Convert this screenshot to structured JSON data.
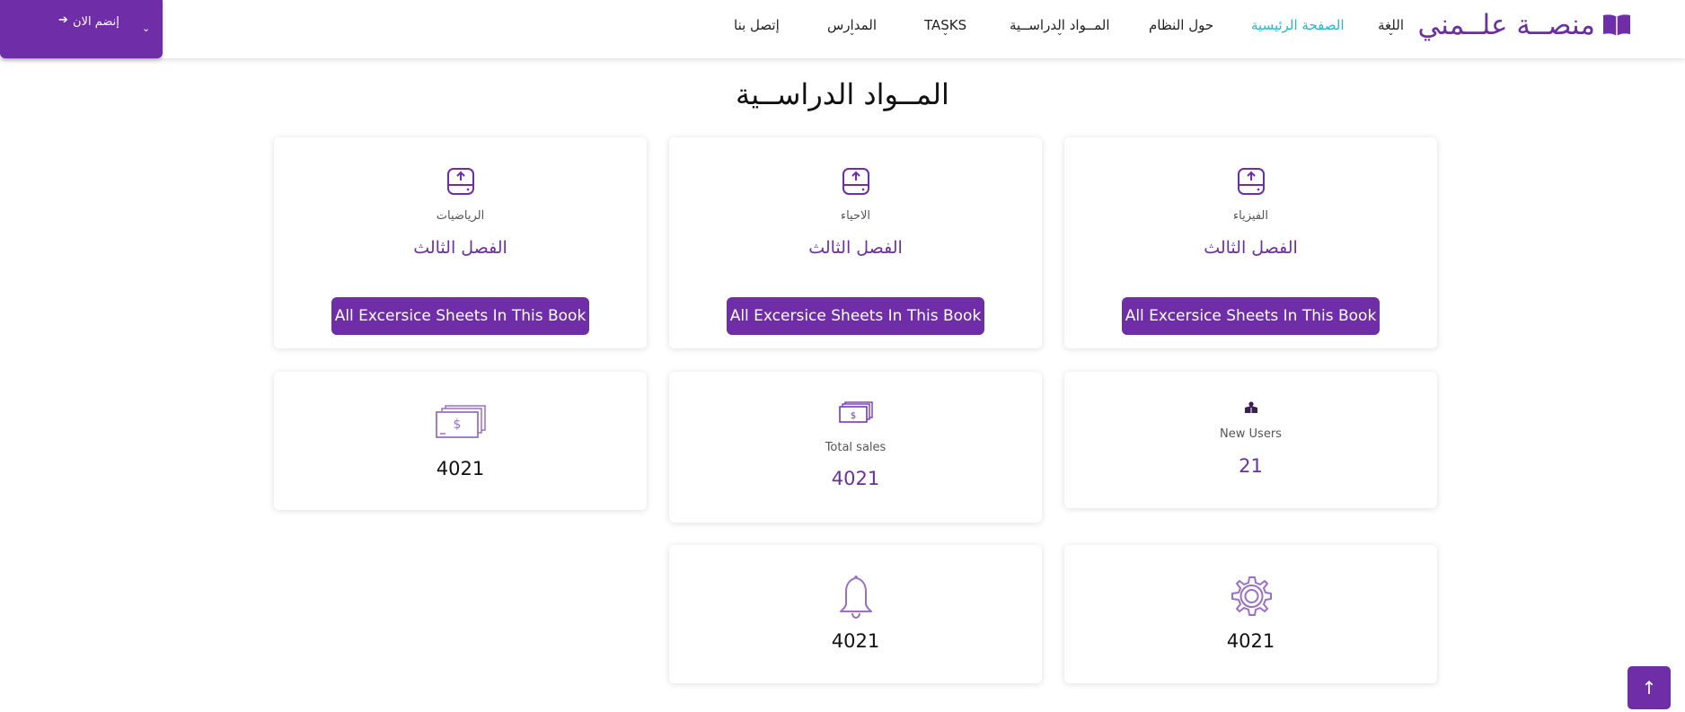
{
  "navbar": {
    "brand": "منصــة علــمني",
    "items": [
      {
        "label": "اللغة",
        "has_caret": true
      },
      {
        "label": "الصفحة الرئيسية",
        "active": true
      },
      {
        "label": "حول النظام"
      },
      {
        "label": "المــواد الدراســية",
        "has_caret": true
      },
      {
        "label": "TASKS",
        "has_caret": true
      },
      {
        "label": "المدارس",
        "has_caret": true
      },
      {
        "label": "إتصل بنا"
      }
    ],
    "join_label": "إنضم الان",
    "join_arrow": "➔",
    "caret": "⌄"
  },
  "section_title": "المــواد الدراســية",
  "subjects": [
    {
      "name": "الفيزياء",
      "term": "الفصل الثالث",
      "button": "All Excersice Sheets In This Book"
    },
    {
      "name": "الاحياء",
      "term": "الفصل الثالث",
      "button": "All Excersice Sheets In This Book"
    },
    {
      "name": "الرياضيات",
      "term": "الفصل الثالث",
      "button": "All Excersice Sheets In This Book"
    }
  ],
  "stats": {
    "new_users": {
      "label": "New Users",
      "value": "21",
      "icon": "user-box-icon"
    },
    "total_sales": {
      "label": "Total sales",
      "value": "4021",
      "icon": "money-stack-icon"
    },
    "money_big": {
      "value": "4021",
      "icon": "money-stack-icon"
    },
    "settings": {
      "value": "4021",
      "icon": "gear-icon"
    },
    "notifications": {
      "value": "4021",
      "icon": "bell-icon"
    }
  },
  "scroll_top_glyph": "↑",
  "colors": {
    "primary": "#6f2da8",
    "brand_text": "#6b2fa0",
    "active_nav": "#22b8cf"
  }
}
